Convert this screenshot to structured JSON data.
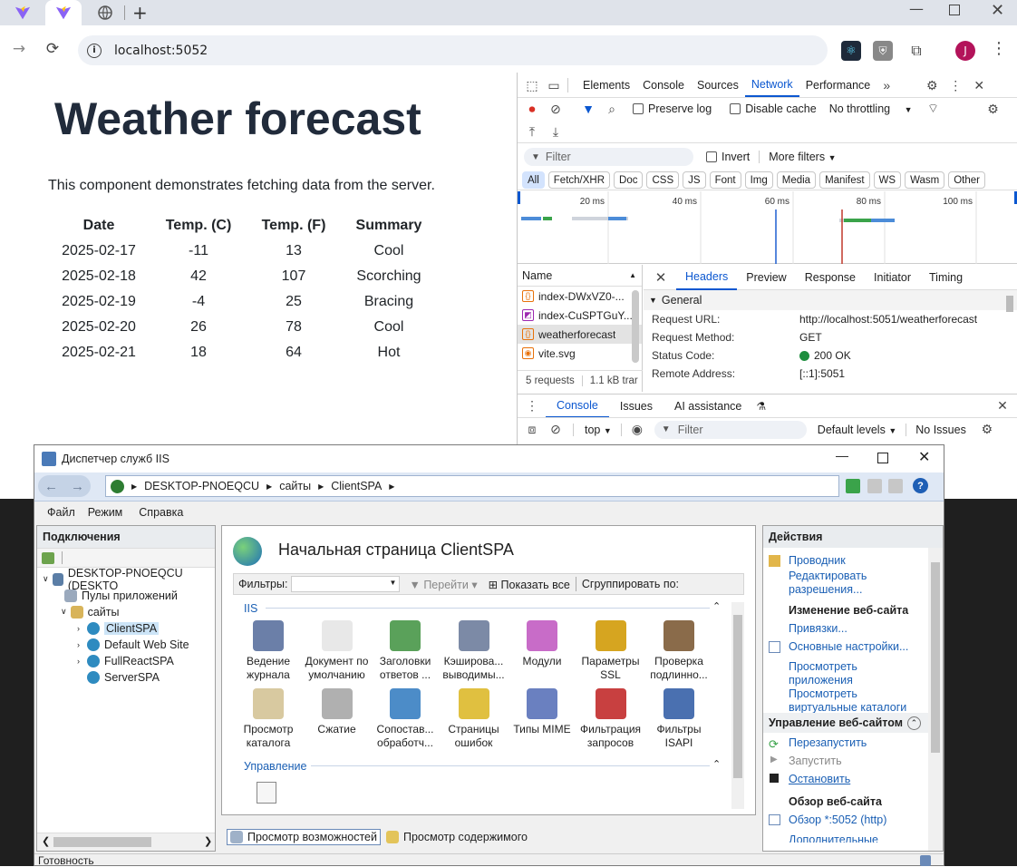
{
  "browser": {
    "address": "localhost:5052",
    "profile_initial": "J"
  },
  "page": {
    "title": "Weather forecast",
    "description": "This component demonstrates fetching data from the server.",
    "table": {
      "headers": [
        "Date",
        "Temp. (C)",
        "Temp. (F)",
        "Summary"
      ],
      "rows": [
        [
          "2025-02-17",
          "-11",
          "13",
          "Cool"
        ],
        [
          "2025-02-18",
          "42",
          "107",
          "Scorching"
        ],
        [
          "2025-02-19",
          "-4",
          "25",
          "Bracing"
        ],
        [
          "2025-02-20",
          "26",
          "78",
          "Cool"
        ],
        [
          "2025-02-21",
          "18",
          "64",
          "Hot"
        ]
      ]
    }
  },
  "devtools": {
    "tabs": [
      "Elements",
      "Console",
      "Sources",
      "Network",
      "Performance"
    ],
    "active_tab": "Network",
    "preserve_log": "Preserve log",
    "disable_cache": "Disable cache",
    "throttling": "No throttling",
    "filter_placeholder": "Filter",
    "invert": "Invert",
    "more_filters": "More filters",
    "type_chips": [
      "All",
      "Fetch/XHR",
      "Doc",
      "CSS",
      "JS",
      "Font",
      "Img",
      "Media",
      "Manifest",
      "WS",
      "Wasm",
      "Other"
    ],
    "timeline_ticks": [
      "20 ms",
      "40 ms",
      "60 ms",
      "80 ms",
      "100 ms"
    ],
    "name_header": "Name",
    "requests": [
      "index-DWxVZ0-...",
      "index-CuSPTGuY...",
      "weatherforecast",
      "vite.svg"
    ],
    "summary_requests": "5 requests",
    "summary_transfer": "1.1 kB trar",
    "detail_tabs": [
      "Headers",
      "Preview",
      "Response",
      "Initiator",
      "Timing"
    ],
    "general_label": "General",
    "general": [
      {
        "k": "Request URL:",
        "v": "http://localhost:5051/weatherforecast"
      },
      {
        "k": "Request Method:",
        "v": "GET"
      },
      {
        "k": "Status Code:",
        "v": "200 OK"
      },
      {
        "k": "Remote Address:",
        "v": "[::1]:5051"
      }
    ],
    "drawer_tabs": [
      "Console",
      "Issues",
      "AI assistance"
    ],
    "context": "top",
    "console_filter": "Filter",
    "default_levels": "Default levels",
    "no_issues": "No Issues"
  },
  "iis": {
    "window_title": "Диспетчер служб IIS",
    "breadcrumb": [
      "DESKTOP-PNOEQCU",
      "сайты",
      "ClientSPA"
    ],
    "menu": [
      "Файл",
      "Режим",
      "Справка"
    ],
    "connections_title": "Подключения",
    "tree": {
      "root": "DESKTOP-PNOEQCU (DESKTO",
      "app_pools": "Пулы приложений",
      "sites": "сайты",
      "site_items": [
        "ClientSPA",
        "Default Web Site",
        "FullReactSPA",
        "ServerSPA"
      ]
    },
    "home_title": "Начальная страница ClientSPA",
    "filter_label": "Фильтры:",
    "goto": "Перейти",
    "show_all": "Показать все",
    "group_by": "Сгруппировать по:",
    "group_iis": "IIS",
    "group_manage": "Управление",
    "features_row1": [
      {
        "l1": "Ведение",
        "l2": "журнала",
        "c": "#6b7fa8"
      },
      {
        "l1": "Документ по",
        "l2": "умолчанию",
        "c": "#e8e8e8"
      },
      {
        "l1": "Заголовки",
        "l2": "ответов ...",
        "c": "#5aa15a"
      },
      {
        "l1": "Кэширова...",
        "l2": "выводимы...",
        "c": "#7c8aa6"
      },
      {
        "l1": "Модули",
        "l2": "",
        "c": "#c86cc8"
      },
      {
        "l1": "Параметры",
        "l2": "SSL",
        "c": "#d6a520"
      },
      {
        "l1": "Проверка",
        "l2": "подлинно...",
        "c": "#8a6b4a"
      }
    ],
    "features_row2": [
      {
        "l1": "Просмотр",
        "l2": "каталога",
        "c": "#d8c9a0"
      },
      {
        "l1": "Сжатие",
        "l2": "",
        "c": "#b0b0b0"
      },
      {
        "l1": "Сопостав...",
        "l2": "обработч...",
        "c": "#4c8cc8"
      },
      {
        "l1": "Страницы",
        "l2": "ошибок",
        "c": "#e0c040"
      },
      {
        "l1": "Типы MIME",
        "l2": "",
        "c": "#6a80c0"
      },
      {
        "l1": "Фильтрация",
        "l2": "запросов",
        "c": "#c84040"
      },
      {
        "l1": "Фильтры",
        "l2": "ISAPI",
        "c": "#4a70b0"
      }
    ],
    "bottom_tabs": [
      "Просмотр возможностей",
      "Просмотр содержимого"
    ],
    "actions_title": "Действия",
    "actions": {
      "explorer": "Проводник",
      "edit_perms": [
        "Редактировать",
        "разрешения..."
      ],
      "edit_site": "Изменение веб-сайта",
      "bindings": "Привязки...",
      "basic": "Основные настройки...",
      "view_apps": [
        "Просмотреть",
        "приложения"
      ],
      "view_vdirs": [
        "Просмотреть",
        "виртуальные каталоги"
      ],
      "manage_site": "Управление веб-сайтом",
      "restart": "Перезапустить",
      "start": "Запустить",
      "stop": "Остановить",
      "browse_site": "Обзор веб-сайта",
      "browse": "Обзор *:5052 (http)",
      "more": "Дополнительные"
    },
    "status": "Готовность"
  }
}
